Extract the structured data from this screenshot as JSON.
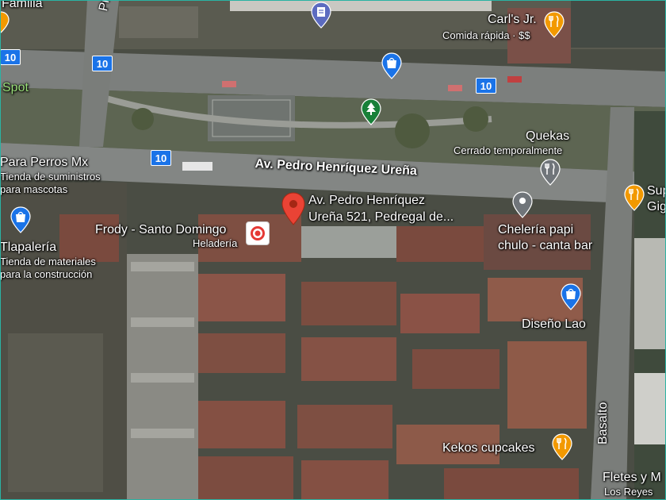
{
  "labels": {
    "familia": "Familia",
    "prof": "Prof",
    "spot": "Spot",
    "carls": "Carl's Jr.",
    "carls_sub": "Comida rápida · $$",
    "quekas": "Quekas",
    "quekas_sub": "Cerrado temporalmente",
    "perros": "Para Perros Mx",
    "perros_sub1": "Tienda de suministros",
    "perros_sub2": "para mascotas",
    "avenue": "Av. Pedro Henríquez Ureña",
    "address_line1": "Av. Pedro Henríquez",
    "address_line2": "Ureña 521, Pedregal de...",
    "frody": "Frody - Santo Domingo",
    "frody_sub": "Heladería",
    "tlapaleria": "Tlapalería",
    "tlapaleria_sub1": "Tienda de materiales",
    "tlapaleria_sub2": "para la construcción",
    "super": "Sup",
    "super2": "Gig",
    "cheleria1": "Chelería papi",
    "cheleria2": "chulo - canta bar",
    "diseno": "Diseño Lao",
    "basalto": "Basalto",
    "kekos": "Kekos cupcakes",
    "fletes1": "Fletes y M",
    "fletes2": "Los Reyes"
  },
  "route_shields": [
    "10",
    "10",
    "10",
    "10"
  ],
  "colors": {
    "shield": "#1a73e8",
    "pin_red": "#ea4335",
    "food_pin": "#f29900",
    "shop_pin": "#1a73e8",
    "park_pin": "#188038",
    "gray_pin": "#70757a"
  },
  "icons": [
    "food-pin-icon",
    "shopping-pin-icon",
    "park-pin-icon",
    "location-pin-icon",
    "ice-cream-icon",
    "place-pin-icon"
  ]
}
